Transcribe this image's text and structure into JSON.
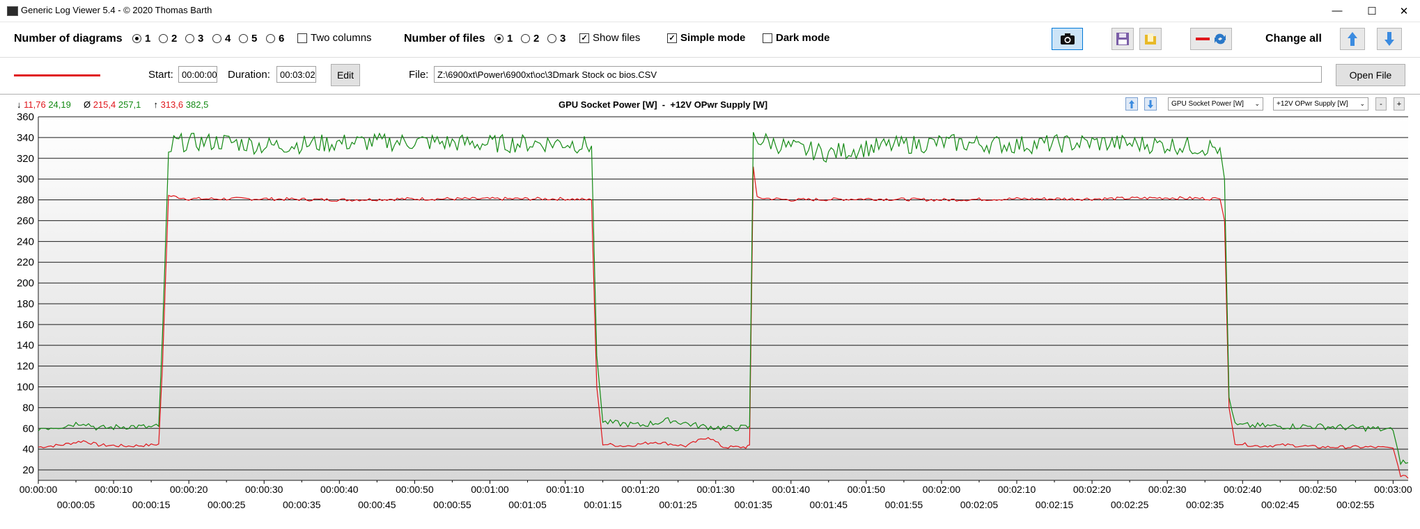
{
  "window": {
    "title": "Generic Log Viewer 5.4 - © 2020 Thomas Barth",
    "minimize": "—",
    "maximize": "☐",
    "close": "✕"
  },
  "toolbar": {
    "diagrams_label": "Number of diagrams",
    "diagram_options": [
      "1",
      "2",
      "3",
      "4",
      "5",
      "6"
    ],
    "diagram_selected": "1",
    "two_columns": "Two columns",
    "files_label": "Number of files",
    "file_options": [
      "1",
      "2",
      "3"
    ],
    "file_selected": "1",
    "show_files": "Show files",
    "simple_mode": "Simple mode",
    "dark_mode": "Dark mode",
    "change_all": "Change all"
  },
  "file_bar": {
    "start_label": "Start:",
    "start_value": "00:00:00",
    "duration_label": "Duration:",
    "duration_value": "00:03:02",
    "edit_button": "Edit",
    "file_label": "File:",
    "file_path": "Z:\\6900xt\\Power\\6900xt\\oc\\3Dmark Stock oc bios.CSV",
    "open_button": "Open File",
    "line_color": "#e0161b"
  },
  "chart_header": {
    "min_symbol": "↓",
    "min_red": "11,76",
    "min_green": "24,19",
    "avg_symbol": "Ø",
    "avg_red": "215,4",
    "avg_green": "257,1",
    "max_symbol": "↑",
    "max_red": "313,6",
    "max_green": "382,5",
    "title": "GPU Socket Power [W]  -  +12V OPwr Supply [W]",
    "select1": "GPU Socket Power [W]",
    "select2": "+12V OPwr Supply [W]",
    "minus": "-",
    "plus": "+"
  },
  "colors": {
    "series1": "#e0161b",
    "series2": "#148a14",
    "accent": "#0078d7"
  },
  "chart_data": {
    "type": "line",
    "title": "GPU Socket Power [W]  -  +12V OPwr Supply [W]",
    "ylim": [
      10,
      360
    ],
    "y_ticks": [
      20,
      40,
      60,
      80,
      100,
      120,
      140,
      160,
      180,
      200,
      220,
      240,
      260,
      280,
      300,
      320,
      340,
      360
    ],
    "x_ticks_top": [
      "00:00:00",
      "00:00:10",
      "00:00:20",
      "00:00:30",
      "00:00:40",
      "00:00:50",
      "00:01:00",
      "00:01:10",
      "00:01:20",
      "00:01:30",
      "00:01:40",
      "00:01:50",
      "00:02:00",
      "00:02:10",
      "00:02:20",
      "00:02:30",
      "00:02:40",
      "00:02:50",
      "00:03:00"
    ],
    "x_ticks_bottom": [
      "00:00:05",
      "00:00:15",
      "00:00:25",
      "00:00:35",
      "00:00:45",
      "00:00:55",
      "00:01:05",
      "00:01:15",
      "00:01:25",
      "00:01:35",
      "00:01:45",
      "00:01:55",
      "00:02:05",
      "00:02:15",
      "00:02:25",
      "00:02:35",
      "00:02:45",
      "00:02:55"
    ],
    "x_range_seconds": [
      0,
      182
    ],
    "grid": true,
    "series": [
      {
        "name": "GPU Socket Power [W]",
        "points": [
          [
            0,
            42
          ],
          [
            3,
            44
          ],
          [
            6,
            48
          ],
          [
            8,
            44
          ],
          [
            12,
            43
          ],
          [
            15,
            44
          ],
          [
            16,
            45
          ],
          [
            16.5,
            120
          ],
          [
            17.3,
            284
          ],
          [
            20,
            281
          ],
          [
            30,
            281
          ],
          [
            40,
            280
          ],
          [
            50,
            281
          ],
          [
            60,
            281
          ],
          [
            70,
            281
          ],
          [
            73.5,
            280
          ],
          [
            74.2,
            100
          ],
          [
            75,
            45
          ],
          [
            78,
            43
          ],
          [
            82,
            47
          ],
          [
            86,
            43
          ],
          [
            89,
            52
          ],
          [
            91,
            42
          ],
          [
            94,
            42
          ],
          [
            94.5,
            44
          ],
          [
            95,
            312
          ],
          [
            95.5,
            282
          ],
          [
            100,
            280
          ],
          [
            110,
            281
          ],
          [
            120,
            280
          ],
          [
            130,
            281
          ],
          [
            140,
            281
          ],
          [
            150,
            282
          ],
          [
            157,
            281
          ],
          [
            157.6,
            260
          ],
          [
            158.2,
            80
          ],
          [
            159,
            46
          ],
          [
            162,
            43
          ],
          [
            166,
            44
          ],
          [
            170,
            42
          ],
          [
            177,
            42
          ],
          [
            180,
            41
          ],
          [
            181,
            15
          ],
          [
            182,
            12
          ]
        ]
      },
      {
        "name": "+12V OPwr Supply [W]",
        "points": [
          [
            0,
            60
          ],
          [
            3,
            62
          ],
          [
            6,
            66
          ],
          [
            8,
            60
          ],
          [
            12,
            62
          ],
          [
            15,
            61
          ],
          [
            16,
            62
          ],
          [
            16.5,
            150
          ],
          [
            17.3,
            322
          ],
          [
            18,
            335
          ],
          [
            25,
            336
          ],
          [
            30,
            332
          ],
          [
            40,
            335
          ],
          [
            50,
            336
          ],
          [
            60,
            334
          ],
          [
            70,
            335
          ],
          [
            73.5,
            332
          ],
          [
            74.2,
            130
          ],
          [
            75,
            66
          ],
          [
            80,
            63
          ],
          [
            84,
            68
          ],
          [
            88,
            62
          ],
          [
            92,
            60
          ],
          [
            94,
            61
          ],
          [
            94.5,
            62
          ],
          [
            95,
            340
          ],
          [
            100,
            330
          ],
          [
            105,
            325
          ],
          [
            110,
            330
          ],
          [
            115,
            333
          ],
          [
            120,
            335
          ],
          [
            130,
            333
          ],
          [
            140,
            335
          ],
          [
            150,
            333
          ],
          [
            157,
            330
          ],
          [
            157.6,
            300
          ],
          [
            158.2,
            90
          ],
          [
            159,
            63
          ],
          [
            165,
            62
          ],
          [
            170,
            62
          ],
          [
            177,
            60
          ],
          [
            180,
            58
          ],
          [
            181,
            28
          ],
          [
            182,
            27
          ]
        ]
      }
    ]
  }
}
